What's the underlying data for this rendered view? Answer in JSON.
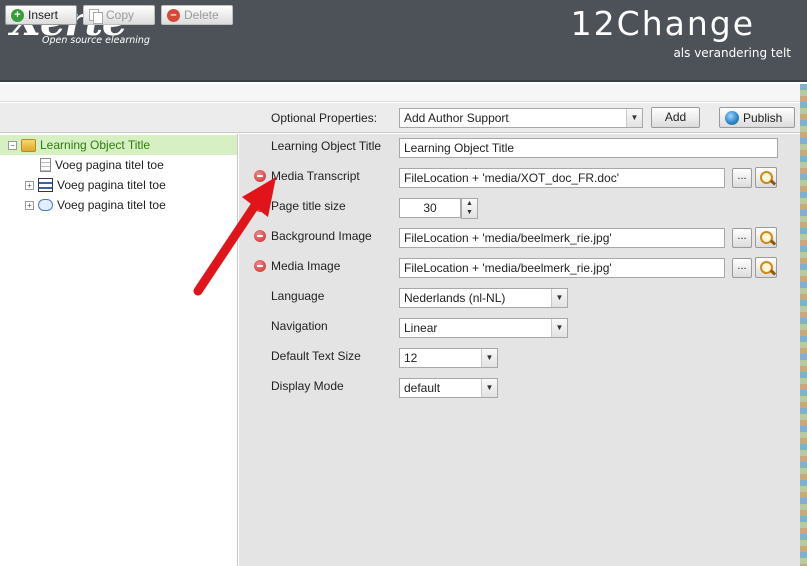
{
  "header": {
    "logo_text": "Xerte",
    "logo_tagline": "Open source elearning",
    "brand_title": "12Change",
    "brand_subtitle": "als verandering telt"
  },
  "toolbar": {
    "insert_label": "Insert",
    "copy_label": "Copy",
    "delete_label": "Delete",
    "optional_properties_label": "Optional Properties:",
    "optional_properties_value": "Add Author Support",
    "add_label": "Add",
    "publish_label": "Publish"
  },
  "tree": {
    "root": "Learning Object Title",
    "items": [
      {
        "label": "Voeg pagina titel toe",
        "icon": "page-icon"
      },
      {
        "label": "Voeg pagina titel toe",
        "icon": "list-page-icon"
      },
      {
        "label": "Voeg pagina titel toe",
        "icon": "chat-page-icon"
      }
    ]
  },
  "properties": {
    "learning_object_title": {
      "label": "Learning Object Title",
      "value": "Learning Object Title"
    },
    "media_transcript": {
      "label": "Media Transcript",
      "value": "FileLocation + 'media/XOT_doc_FR.doc'"
    },
    "page_title_size": {
      "label": "Page title size",
      "value": "30"
    },
    "background_image": {
      "label": "Background Image",
      "value": "FileLocation + 'media/beelmerk_rie.jpg'"
    },
    "media_image": {
      "label": "Media Image",
      "value": "FileLocation + 'media/beelmerk_rie.jpg'"
    },
    "language": {
      "label": "Language",
      "value": "Nederlands (nl-NL)"
    },
    "navigation": {
      "label": "Navigation",
      "value": "Linear"
    },
    "default_text_size": {
      "label": "Default Text Size",
      "value": "12"
    },
    "display_mode": {
      "label": "Display Mode",
      "value": "default"
    },
    "browse_label": "..."
  },
  "colors": {
    "header_bg": "#4d5258",
    "selected_tree_bg": "#d6f0c4",
    "panel_bg": "#e4e4e4",
    "arrow": "#e0141a"
  }
}
